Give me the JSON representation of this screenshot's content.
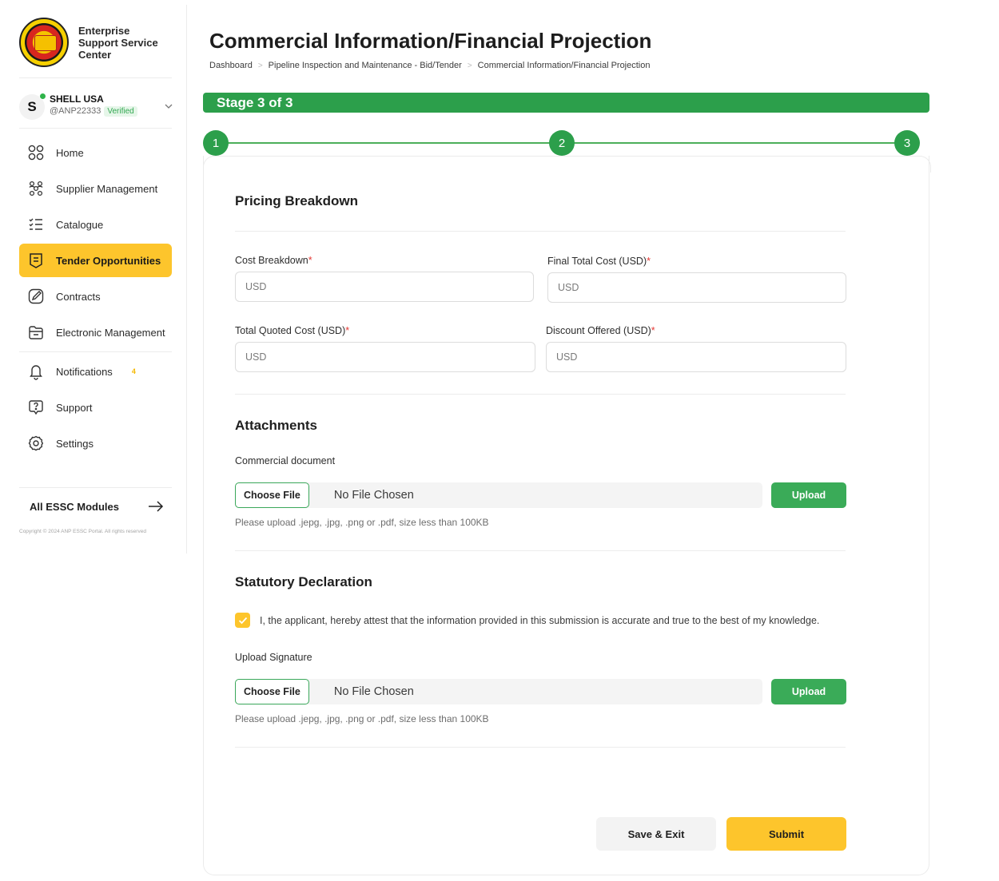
{
  "brand": {
    "name": "Enterprise Support Service Center"
  },
  "account": {
    "initial": "S",
    "name": "SHELL USA",
    "handle": "@ANP22333",
    "badge": "Verified"
  },
  "sidebar": {
    "items": [
      {
        "label": "Home",
        "icon": "grid-circles-icon"
      },
      {
        "label": "Supplier Management",
        "icon": "people-network-icon"
      },
      {
        "label": "Catalogue",
        "icon": "list-icon"
      },
      {
        "label": "Tender Opportunities",
        "icon": "document-lines-icon",
        "active": true
      },
      {
        "label": "Contracts",
        "icon": "pen-icon"
      },
      {
        "label": "Electronic Management",
        "icon": "folder-icon"
      },
      {
        "label": "Notifications",
        "icon": "bell-icon",
        "badge": "4"
      },
      {
        "label": "Support",
        "icon": "question-icon"
      },
      {
        "label": "Settings",
        "icon": "gear-icon"
      }
    ],
    "all_modules": "All ESSC Modules",
    "copyright": "Copyright © 2024 ANP ESSC Portal. All rights reserved"
  },
  "page": {
    "title": "Commercial Information/Financial Projection",
    "breadcrumb": [
      "Dashboard",
      "Pipeline Inspection and Maintenance - Bid/Tender",
      "Commercial Information/Financial Projection"
    ],
    "stage": "Stage 3 of 3",
    "steps": [
      "1",
      "2",
      "3"
    ]
  },
  "pricing": {
    "title": "Pricing Breakdown",
    "cost_breakdown": {
      "label": "Cost Breakdown",
      "placeholder": "USD"
    },
    "final_total": {
      "label": "Final Total Cost (USD)",
      "placeholder": "USD"
    },
    "total_quoted": {
      "label": "Total Quoted Cost (USD)",
      "placeholder": "USD"
    },
    "discount": {
      "label": "Discount Offered (USD)",
      "placeholder": "USD"
    },
    "required_mark": "*"
  },
  "attachments": {
    "title": "Attachments",
    "label": "Commercial document",
    "choose": "Choose File",
    "no_file": "No File Chosen",
    "upload": "Upload",
    "hint": "Please upload .jepg, .jpg, .png or .pdf, size less than 100KB"
  },
  "declaration": {
    "title": "Statutory Declaration",
    "text": "I, the applicant, hereby attest that the information provided in this submission is accurate and true to the best of my knowledge.",
    "signature_label": "Upload Signature",
    "choose": "Choose File",
    "no_file": "No File Chosen",
    "upload": "Upload",
    "hint": "Please upload .jepg, .jpg, .png or .pdf, size less than 100KB"
  },
  "actions": {
    "save": "Save & Exit",
    "submit": "Submit"
  },
  "colors": {
    "accent_yellow": "#fdc52c",
    "green": "#2c9f4b",
    "upload_green": "#3aab58",
    "required_red": "#e53935"
  }
}
